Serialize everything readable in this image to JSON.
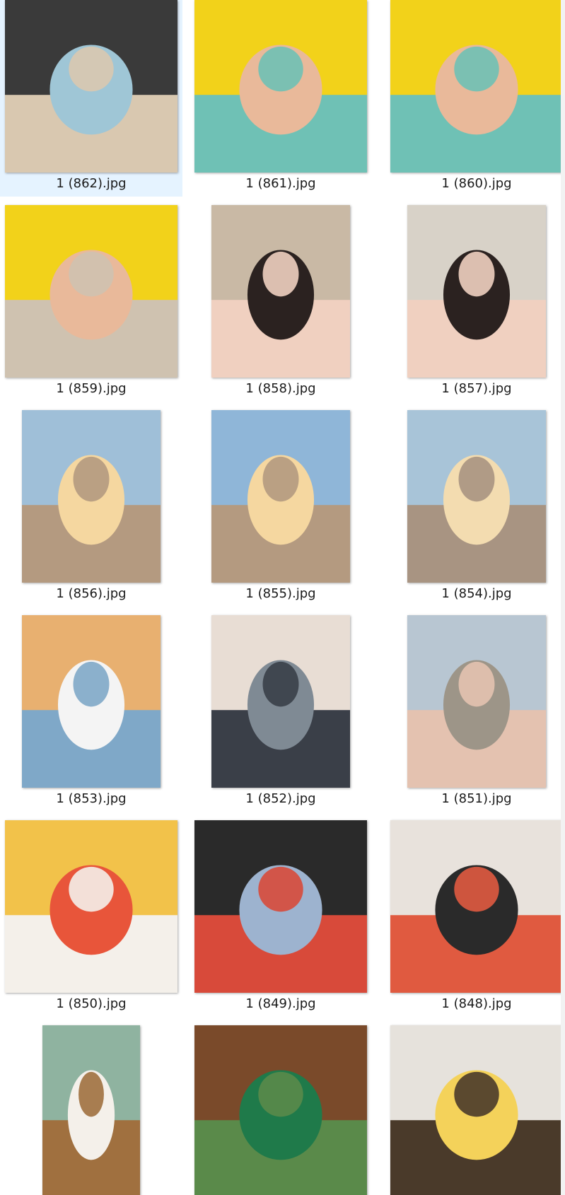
{
  "files": [
    {
      "name": "1 (862).jpg",
      "selected": true,
      "orientation": "landscape",
      "icon": "photo-car-trunk-baby",
      "colors": [
        "#3a3a3a",
        "#9fc6d6",
        "#d9c8b0"
      ]
    },
    {
      "name": "1 (861).jpg",
      "selected": false,
      "orientation": "landscape",
      "icon": "photo-baby-yellow-hat",
      "colors": [
        "#f2d21a",
        "#e9b99a",
        "#6fc1b5"
      ]
    },
    {
      "name": "1 (860).jpg",
      "selected": false,
      "orientation": "landscape",
      "icon": "photo-baby-yellow-hat",
      "colors": [
        "#f2d21a",
        "#e9b99a",
        "#6fc1b5"
      ]
    },
    {
      "name": "1 (859).jpg",
      "selected": false,
      "orientation": "landscape",
      "icon": "photo-baby-yellow-hat",
      "colors": [
        "#f2d21a",
        "#e9b99a",
        "#cfc2b0"
      ]
    },
    {
      "name": "1 (858).jpg",
      "selected": false,
      "orientation": "portrait",
      "icon": "photo-dog-filter-selfie",
      "colors": [
        "#c9b9a5",
        "#2b2220",
        "#f0d0c0"
      ]
    },
    {
      "name": "1 (857).jpg",
      "selected": false,
      "orientation": "portrait",
      "icon": "photo-dog-filter-selfie",
      "colors": [
        "#d8d2c8",
        "#2b2220",
        "#f0d0c0"
      ]
    },
    {
      "name": "1 (856).jpg",
      "selected": false,
      "orientation": "portrait",
      "icon": "photo-beach-sunset",
      "colors": [
        "#9fbfd8",
        "#f5d7a0",
        "#b49a80"
      ]
    },
    {
      "name": "1 (855).jpg",
      "selected": false,
      "orientation": "portrait",
      "icon": "photo-beach-sunset",
      "colors": [
        "#8fb6d8",
        "#f5d7a0",
        "#b49a80"
      ]
    },
    {
      "name": "1 (854).jpg",
      "selected": false,
      "orientation": "portrait",
      "icon": "photo-beach-sunset",
      "colors": [
        "#a8c4d8",
        "#f3dcb0",
        "#a89482"
      ]
    },
    {
      "name": "1 (853).jpg",
      "selected": false,
      "orientation": "portrait",
      "icon": "photo-beach-family-selfie",
      "colors": [
        "#e8b070",
        "#f4f4f4",
        "#7fa8c8"
      ]
    },
    {
      "name": "1 (852).jpg",
      "selected": false,
      "orientation": "portrait",
      "icon": "photo-father-baby-water",
      "colors": [
        "#e8ddd4",
        "#7f8a94",
        "#3a3f48"
      ]
    },
    {
      "name": "1 (851).jpg",
      "selected": false,
      "orientation": "portrait",
      "icon": "photo-baby-sand",
      "colors": [
        "#b8c6d2",
        "#9d9588",
        "#e4c2b0"
      ]
    },
    {
      "name": "1 (850).jpg",
      "selected": false,
      "orientation": "landscape",
      "icon": "photo-restaurant-table",
      "colors": [
        "#f2c24a",
        "#e8553a",
        "#f4f0ea"
      ]
    },
    {
      "name": "1 (849).jpg",
      "selected": false,
      "orientation": "landscape",
      "icon": "photo-baby-stroller",
      "colors": [
        "#2a2a2a",
        "#9db3cf",
        "#d84a3a"
      ]
    },
    {
      "name": "1 (848).jpg",
      "selected": false,
      "orientation": "landscape",
      "icon": "photo-man-baby-mall",
      "colors": [
        "#e8e2dc",
        "#2a2a2a",
        "#e05a40"
      ]
    },
    {
      "name": "",
      "selected": false,
      "orientation": "portrait-narrow",
      "icon": "photo-baby-highchair",
      "colors": [
        "#8fb3a0",
        "#f4f0ea",
        "#a0703f"
      ]
    },
    {
      "name": "",
      "selected": false,
      "orientation": "landscape",
      "icon": "photo-starbucks-tree",
      "colors": [
        "#7a4a2a",
        "#1f7a4a",
        "#5a8a4a"
      ]
    },
    {
      "name": "",
      "selected": false,
      "orientation": "landscape",
      "icon": "photo-baby-lifted",
      "colors": [
        "#e6e2dc",
        "#f4d25a",
        "#4a3a2a"
      ]
    }
  ]
}
